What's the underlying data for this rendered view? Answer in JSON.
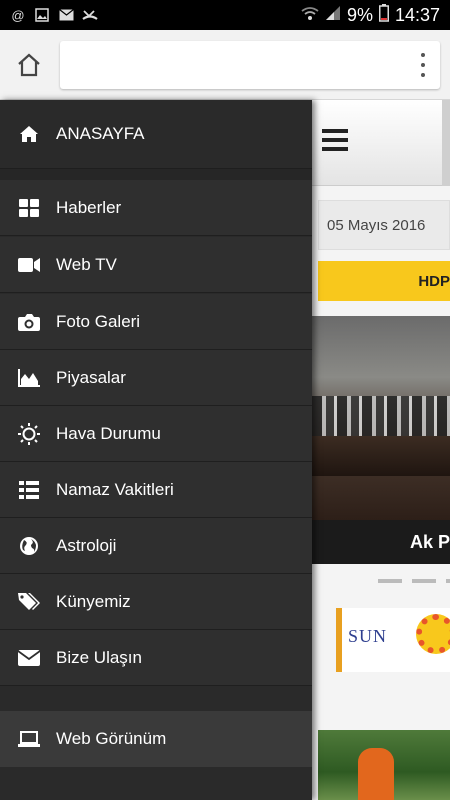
{
  "status_bar": {
    "battery": "9%",
    "time": "14:37"
  },
  "page": {
    "date": "05 Mayıs 2016",
    "ticker": "HDP",
    "headline": "Ak P",
    "ad_text": "SUN"
  },
  "drawer": {
    "home": "ANASAYFA",
    "items": [
      {
        "label": "Haberler",
        "icon": "grid-icon"
      },
      {
        "label": "Web TV",
        "icon": "video-camera-icon"
      },
      {
        "label": "Foto Galeri",
        "icon": "camera-icon"
      },
      {
        "label": "Piyasalar",
        "icon": "area-chart-icon"
      },
      {
        "label": "Hava Durumu",
        "icon": "sun-icon"
      },
      {
        "label": "Namaz Vakitleri",
        "icon": "list-icon"
      },
      {
        "label": "Astroloji",
        "icon": "globe-icon"
      },
      {
        "label": "Künyemiz",
        "icon": "tags-icon"
      },
      {
        "label": "Bize Ulaşın",
        "icon": "envelope-icon"
      }
    ],
    "web_view": "Web Görünüm"
  },
  "colors": {
    "drawer_bg": "#2f2f2f",
    "ticker_bg": "#f8c81c",
    "status_bg": "#000000"
  }
}
